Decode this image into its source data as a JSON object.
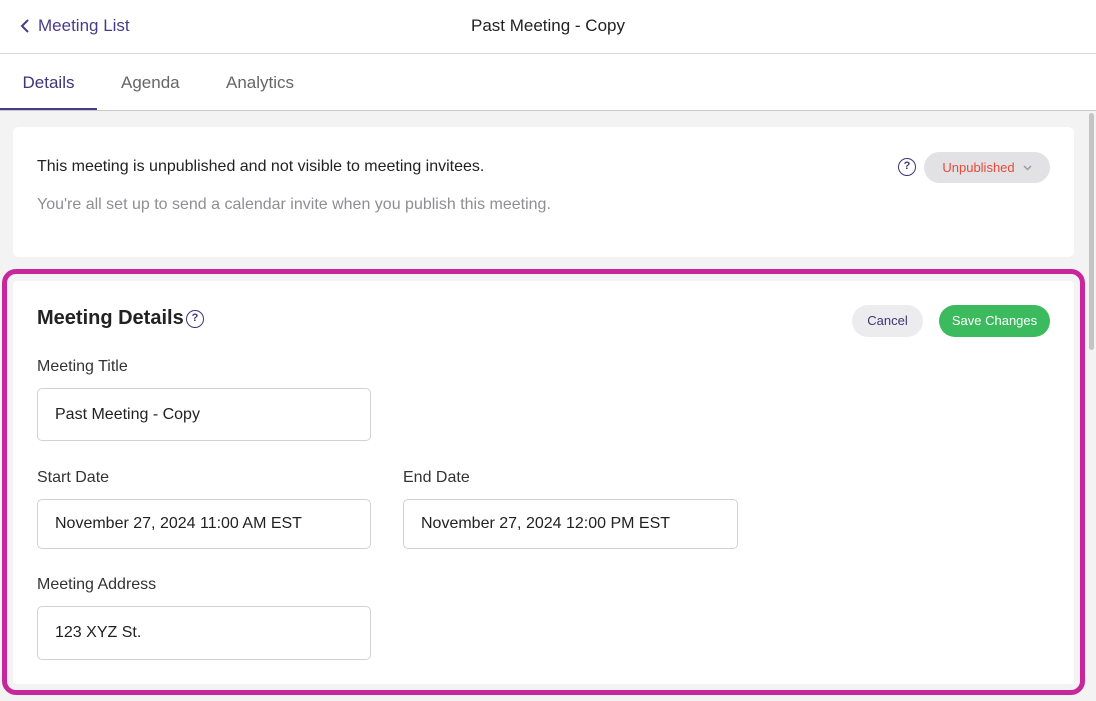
{
  "header": {
    "back_label": "Meeting List",
    "title": "Past Meeting - Copy"
  },
  "tabs": [
    {
      "label": "Details",
      "active": true
    },
    {
      "label": "Agenda",
      "active": false
    },
    {
      "label": "Analytics",
      "active": false
    }
  ],
  "status": {
    "heading": "This meeting is unpublished and not visible to meeting invitees.",
    "subtext": "You're all set up to send a calendar invite when you publish this meeting.",
    "help_icon": "question-circle-icon",
    "publish_state": "Unpublished",
    "publish_state_color": "#e8493d"
  },
  "details": {
    "title": "Meeting Details",
    "help_icon": "question-circle-icon",
    "cancel_label": "Cancel",
    "save_label": "Save Changes",
    "save_color": "#3cba5e",
    "highlight_color": "#c8279b",
    "fields": {
      "title": {
        "label": "Meeting Title",
        "value": "Past Meeting - Copy"
      },
      "start": {
        "label": "Start Date",
        "value": "November 27, 2024 11:00 AM EST"
      },
      "end": {
        "label": "End Date",
        "value": "November 27, 2024 12:00 PM EST"
      },
      "address": {
        "label": "Meeting Address",
        "value": "123 XYZ St."
      }
    }
  },
  "icons": {
    "help_glyph": "?"
  }
}
